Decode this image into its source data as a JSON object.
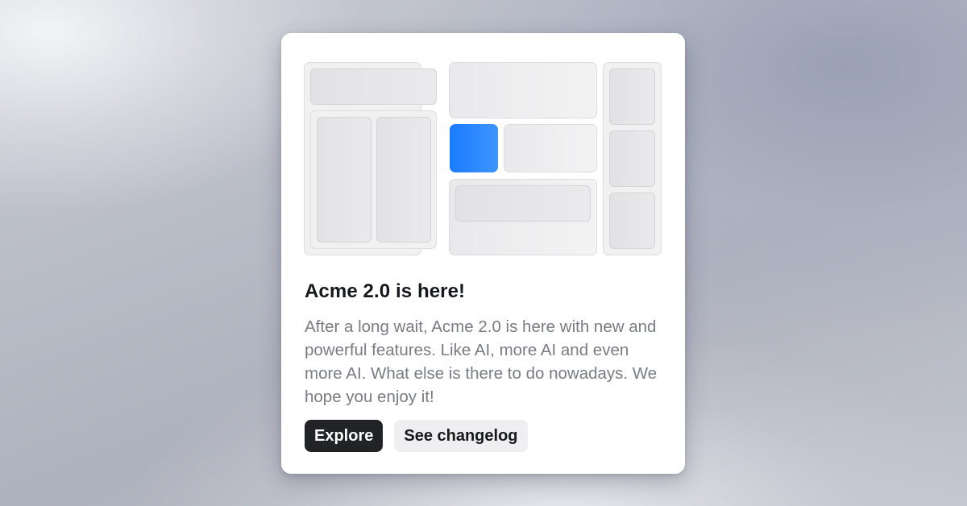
{
  "card": {
    "title": "Acme 2.0 is here!",
    "description": "After a long wait, Acme 2.0 is here with new and powerful features. Like AI, more AI and even more AI. What else is there to do nowadays. We hope you enjoy it!",
    "primary_button": "Explore",
    "secondary_button": "See changelog"
  },
  "colors": {
    "accent": "#1a7bff",
    "primary_button_bg": "#222327",
    "secondary_button_bg": "#efeff2",
    "title_text": "#17181c",
    "body_text": "#7a7c84"
  }
}
